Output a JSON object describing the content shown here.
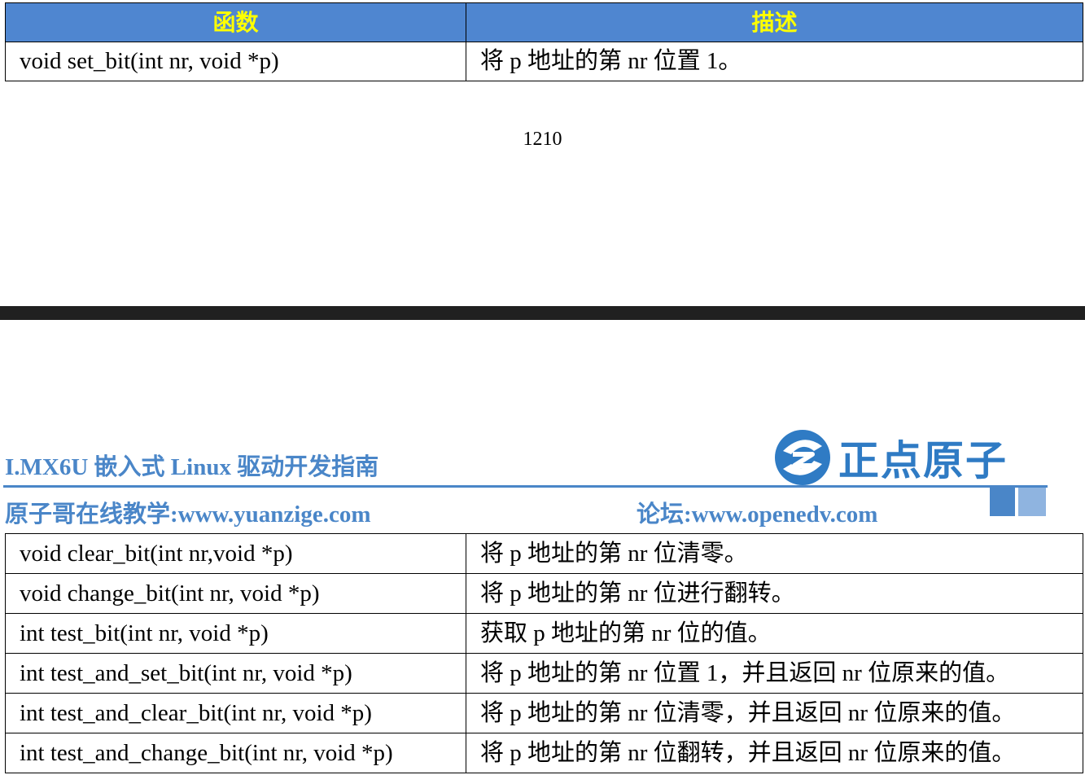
{
  "top_table": {
    "headers": [
      "函数",
      "描述"
    ],
    "rows": [
      [
        "void set_bit(int nr, void *p)",
        "将 p 地址的第 nr 位置 1。"
      ]
    ]
  },
  "page_number": "1210",
  "header": {
    "title": "I.MX6U 嵌入式 Linux 驱动开发指南",
    "site": "原子哥在线教学:www.yuanzige.com",
    "forum": "论坛:www.openedv.com",
    "logo_text": "正点原子",
    "logo_icon": "brand-swirl-logo-icon",
    "accent_color": "#4a86c8"
  },
  "bottom_table": {
    "rows": [
      [
        "void clear_bit(int nr,void *p)",
        "将 p 地址的第 nr 位清零。"
      ],
      [
        "void change_bit(int nr, void *p)",
        "将 p 地址的第 nr 位进行翻转。"
      ],
      [
        "int test_bit(int nr, void *p)",
        "获取 p 地址的第 nr 位的值。"
      ],
      [
        "int test_and_set_bit(int nr, void *p)",
        "将 p 地址的第 nr 位置 1，并且返回 nr 位原来的值。"
      ],
      [
        "int test_and_clear_bit(int nr, void *p)",
        "将 p 地址的第 nr 位清零，并且返回 nr 位原来的值。"
      ],
      [
        "int test_and_change_bit(int nr, void *p)",
        "将 p 地址的第 nr 位翻转，并且返回 nr 位原来的值。"
      ]
    ]
  }
}
